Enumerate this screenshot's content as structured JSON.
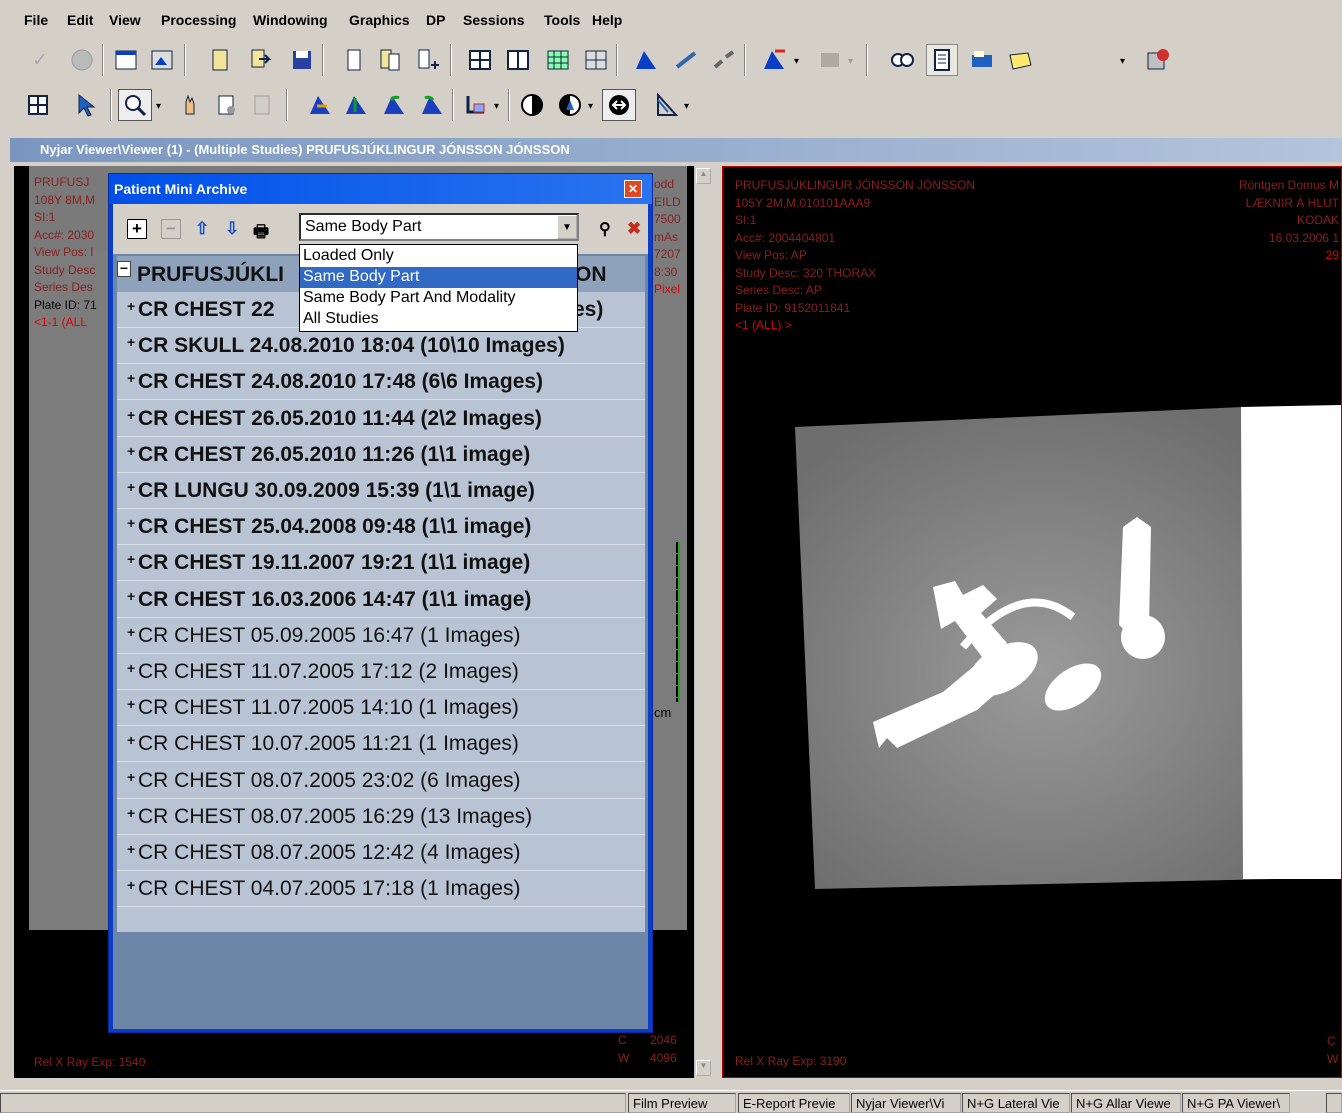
{
  "menu": [
    "File",
    "Edit",
    "View",
    "Processing",
    "Windowing",
    "Graphics",
    "DP",
    "Sessions",
    "Tools",
    "Help"
  ],
  "toolbar1_icons": [
    "check-icon",
    "circle-icon",
    "film-icon",
    "puzzle-icon",
    "book-icon",
    "export-icon",
    "save-icon",
    "document-icon",
    "study-icon",
    "add-study-icon",
    "layout-icon",
    "split-icon",
    "grid-icon",
    "series-icon",
    "tool-a-icon",
    "link-icon",
    "unlink-icon",
    "tool-b-icon",
    "stamp-icon",
    "camera-icon",
    "report-icon",
    "keyboard-icon",
    "note-icon",
    "settings-icon"
  ],
  "toolbar2_icons": [
    "grid2-icon",
    "pointer-icon",
    "zoom-icon",
    "hand-icon",
    "rotate-icon",
    "measure-icon",
    "flip-h-icon",
    "flip-v-icon",
    "rotate-left-icon",
    "rotate-right-icon",
    "roi-icon",
    "contrast-icon",
    "window-icon",
    "invert-icon",
    "angle-icon"
  ],
  "mdi_title": "Nyjar Viewer\\Viewer (1) - (Multiple Studies) PRUFUSJÚKLINGUR JÓNSSON JÓNSSON",
  "left_viewport": {
    "overlay_lines": [
      "PRUFUSJ",
      "108Y 8M,M",
      "SI:1",
      "Acc#: 2030",
      "View Pos: l",
      "Study Desc",
      "Series Des",
      "Plate ID: 71",
      "<1-1 (ALL"
    ],
    "right_lines": [
      "odd",
      "EILD",
      "7500",
      "mAs",
      "7207",
      "8:30",
      "Pixel"
    ],
    "bottom_left": "Rel X Ray Exp: 1540",
    "c_label": "C",
    "c_value": "2046",
    "w_label": "W",
    "w_value": "4096",
    "cm_label": "cm"
  },
  "right_viewport": {
    "overlay_lines": [
      "PRUFUSJÚKLINGUR JÓNSSON JÓNSSON",
      "105Y 2M,M,010101AAA9",
      "SI:1",
      "Acc#: 2004404801",
      "View Pos: AP",
      "Study Desc: 320 THORAX",
      "Series Desc: AP",
      "Plate ID: 9152011841",
      "<1 (ALL) >"
    ],
    "right_lines": [
      "Röntgen Domus M",
      "LÆKNIR Á HLUT",
      "KODAK",
      "",
      "16.03.2006 1",
      "29"
    ],
    "bottom_left": "Rel X Ray Exp: 3190",
    "c_label": "C",
    "w_label": "W"
  },
  "archive": {
    "title": "Patient Mini Archive",
    "combo_value": "Same Body Part",
    "dropdown_options": [
      "Loaded Only",
      "Same Body Part",
      "Same Body Part And Modality",
      "All Studies"
    ],
    "selected_option": 1,
    "patient_header": "PRUFUSJÚKLI",
    "patient_header_tail": "ON",
    "studies": [
      {
        "text": "CR CHEST 22",
        "tail": "es)",
        "bold": true
      },
      {
        "text": "CR SKULL 24.08.2010 18:04 (10\\10 Images)",
        "bold": true
      },
      {
        "text": "CR CHEST 24.08.2010 17:48 (6\\6 Images)",
        "bold": true
      },
      {
        "text": "CR CHEST 26.05.2010 11:44 (2\\2 Images)",
        "bold": true
      },
      {
        "text": "CR CHEST 26.05.2010 11:26 (1\\1 image)",
        "bold": true
      },
      {
        "text": "CR LUNGU 30.09.2009 15:39 (1\\1 image)",
        "bold": true
      },
      {
        "text": "CR CHEST 25.04.2008 09:48 (1\\1 image)",
        "bold": true
      },
      {
        "text": "CR CHEST 19.11.2007 19:21 (1\\1 image)",
        "bold": true
      },
      {
        "text": "CR CHEST 16.03.2006 14:47 (1\\1 image)",
        "bold": true
      },
      {
        "text": "CR CHEST 05.09.2005 16:47 (1 Images)",
        "bold": false
      },
      {
        "text": "CR CHEST 11.07.2005 17:12 (2 Images)",
        "bold": false
      },
      {
        "text": "CR CHEST 11.07.2005 14:10 (1 Images)",
        "bold": false
      },
      {
        "text": "CR CHEST 10.07.2005 11:21 (1 Images)",
        "bold": false
      },
      {
        "text": "CR CHEST 08.07.2005 23:02 (6 Images)",
        "bold": false
      },
      {
        "text": "CR CHEST 08.07.2005 16:29 (13 Images)",
        "bold": false
      },
      {
        "text": "CR CHEST 08.07.2005 12:42 (4 Images)",
        "bold": false
      },
      {
        "text": "CR CHEST 04.07.2005 17:18 (1 Images)",
        "bold": false
      }
    ]
  },
  "status_bar": [
    "Film Preview",
    "E-Report Previe",
    "Nyjar Viewer\\Vi",
    "N+G Lateral Vie",
    "N+G Allar Viewe",
    "N+G PA Viewer\\"
  ]
}
